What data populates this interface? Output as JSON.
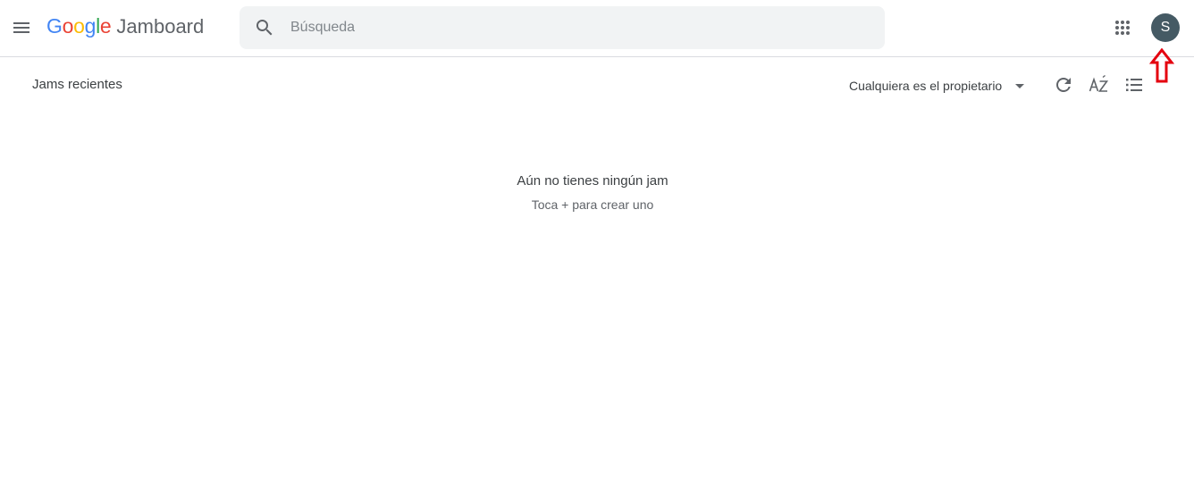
{
  "header": {
    "menu_icon": "hamburger-menu-icon",
    "logo_letters": [
      {
        "ch": "G",
        "color": "#4285F4"
      },
      {
        "ch": "o",
        "color": "#EA4335"
      },
      {
        "ch": "o",
        "color": "#FBBC05"
      },
      {
        "ch": "g",
        "color": "#4285F4"
      },
      {
        "ch": "l",
        "color": "#34A853"
      },
      {
        "ch": "e",
        "color": "#EA4335"
      }
    ],
    "product_name": "Jamboard",
    "search": {
      "placeholder": "Búsqueda",
      "value": "",
      "icon": "search-icon"
    },
    "apps_icon": "apps-grid-icon",
    "avatar_initial": "S",
    "avatar_color": "#455a64"
  },
  "annotation": {
    "icon": "red-up-arrow-icon",
    "color": "#e4000f"
  },
  "toolbar": {
    "title": "Jams recientes",
    "owner_filter": "Cualquiera es el propietario",
    "refresh_icon": "refresh-icon",
    "sort_icon": "sort-az-icon",
    "view_icon": "list-view-icon"
  },
  "empty_state": {
    "title": "Aún no tienes ningún jam",
    "subtitle": "Toca + para crear uno"
  },
  "colors": {
    "icon_gray": "#5f6368",
    "divider": "#dadce0",
    "search_bg": "#f1f3f4"
  }
}
